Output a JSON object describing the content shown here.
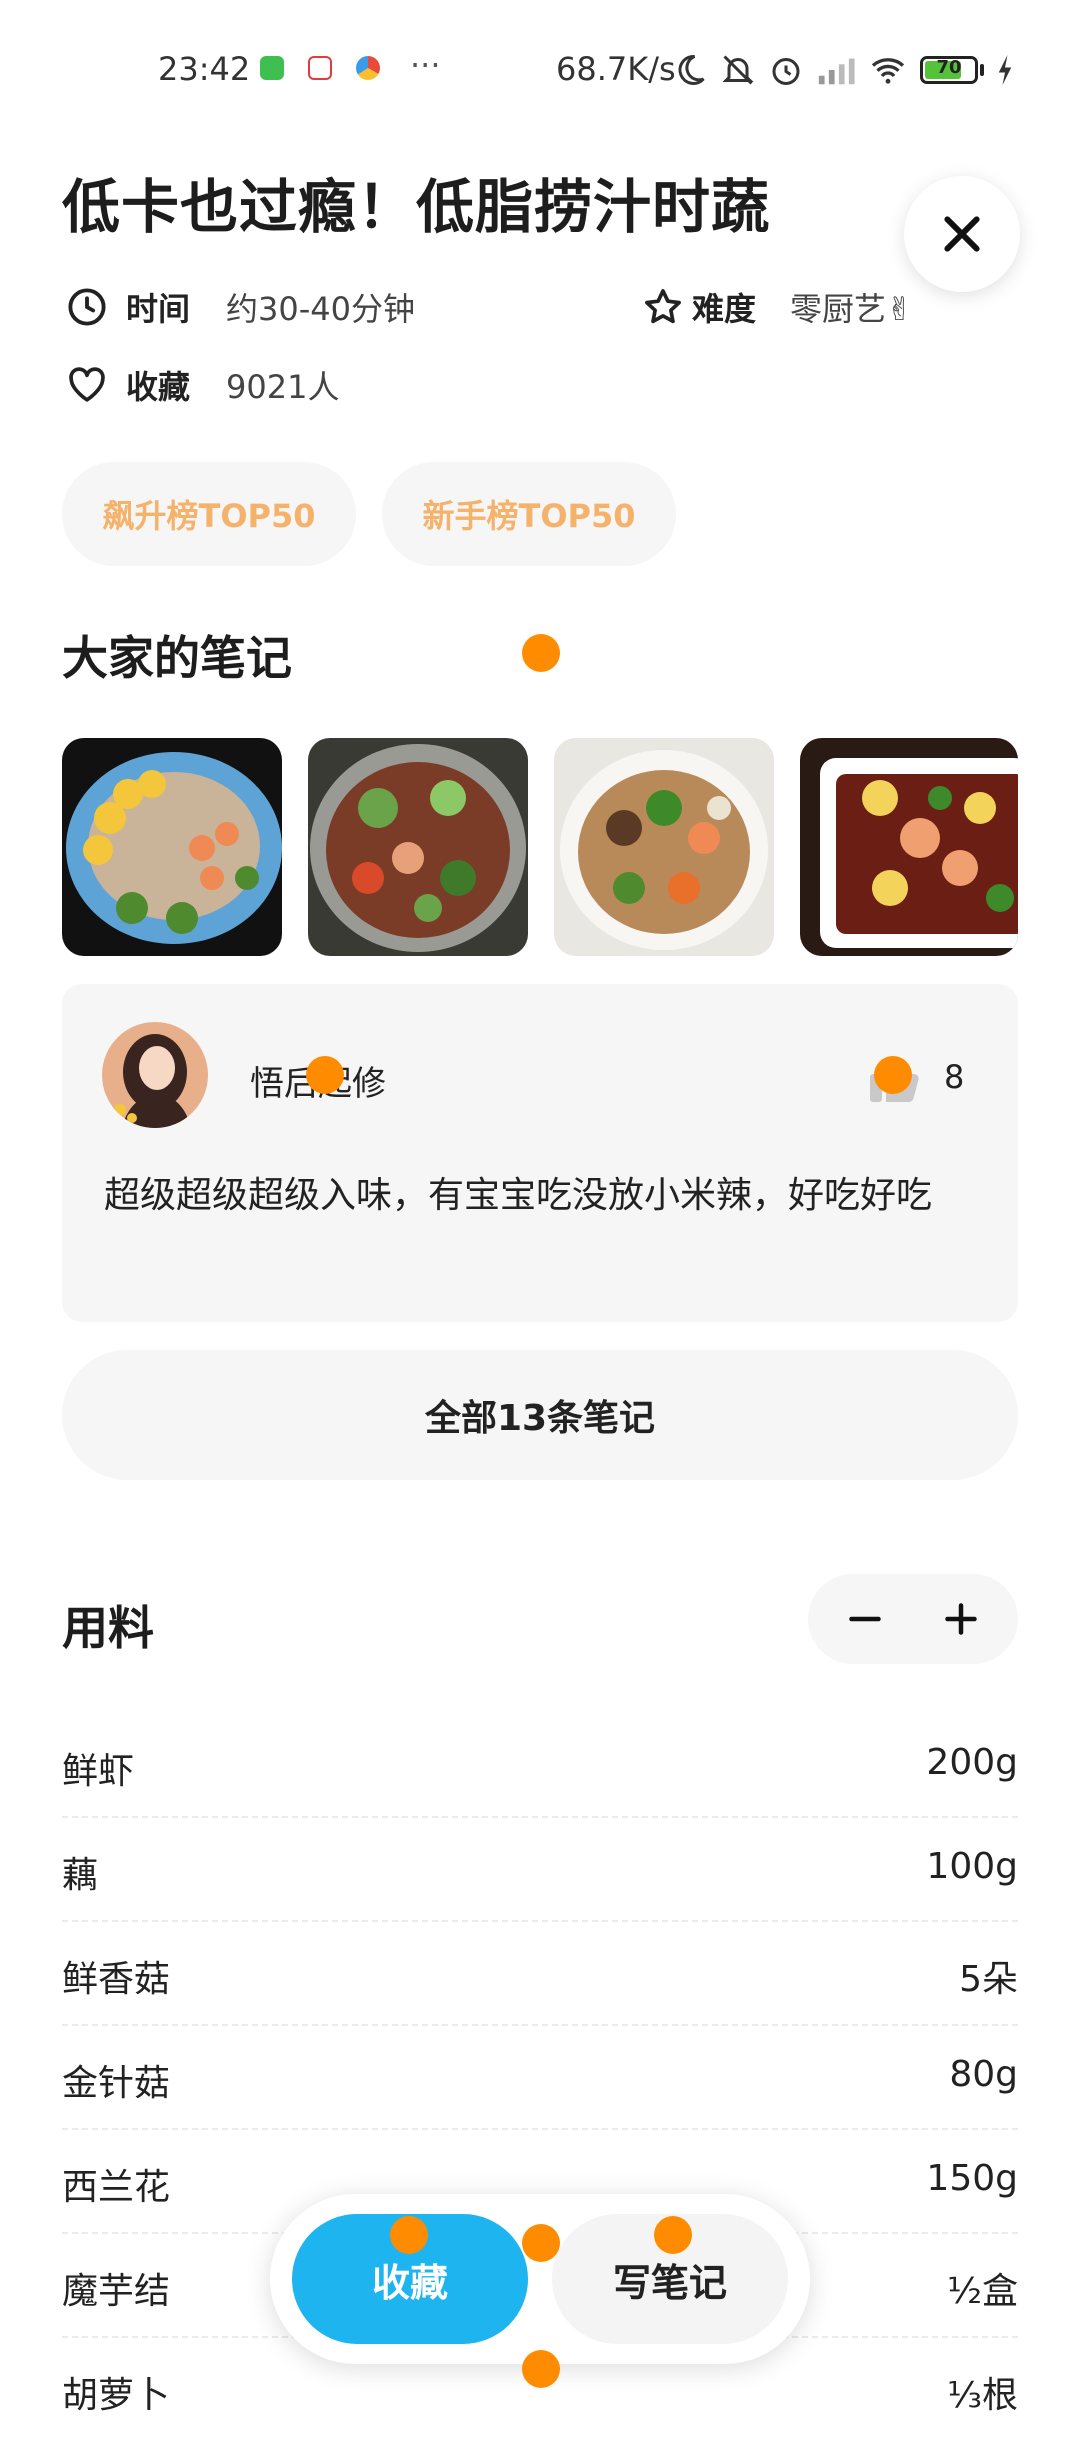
{
  "status_bar": {
    "time": "23:42",
    "dots": "···",
    "net_speed": "68.7K/s",
    "battery": "70"
  },
  "recipe": {
    "title": "低卡也过瘾！低脂捞汁时蔬",
    "time_label": "时间",
    "time_value": "约30-40分钟",
    "difficulty_label": "难度",
    "difficulty_value": "零厨艺✌",
    "favorites_label": "收藏",
    "favorites_value": "9021人",
    "tags": [
      "飙升榜TOP50",
      "新手榜TOP50"
    ]
  },
  "notes": {
    "title": "大家的笔记",
    "note": {
      "user": "悟后起修",
      "likes": "8",
      "text": "超级超级超级入味，有宝宝吃没放小米辣，好吃好吃"
    },
    "all_notes_label": "全部13条笔记"
  },
  "ingredients": {
    "title": "用料",
    "items": [
      {
        "name": "鲜虾",
        "amount": "200g"
      },
      {
        "name": "藕",
        "amount": "100g"
      },
      {
        "name": "鲜香菇",
        "amount": "5朵"
      },
      {
        "name": "金针菇",
        "amount": "80g"
      },
      {
        "name": "西兰花",
        "amount": "150g"
      },
      {
        "name": "魔芋结",
        "amount": "½盒"
      },
      {
        "name": "胡萝卜",
        "amount": "⅓根"
      }
    ]
  },
  "bottom_bar": {
    "favorite_label": "收藏",
    "write_note_label": "写笔记"
  },
  "colors": {
    "accent": "#1eb4f0",
    "tag_text": "#f5b26b",
    "marker": "#ff8c00"
  }
}
